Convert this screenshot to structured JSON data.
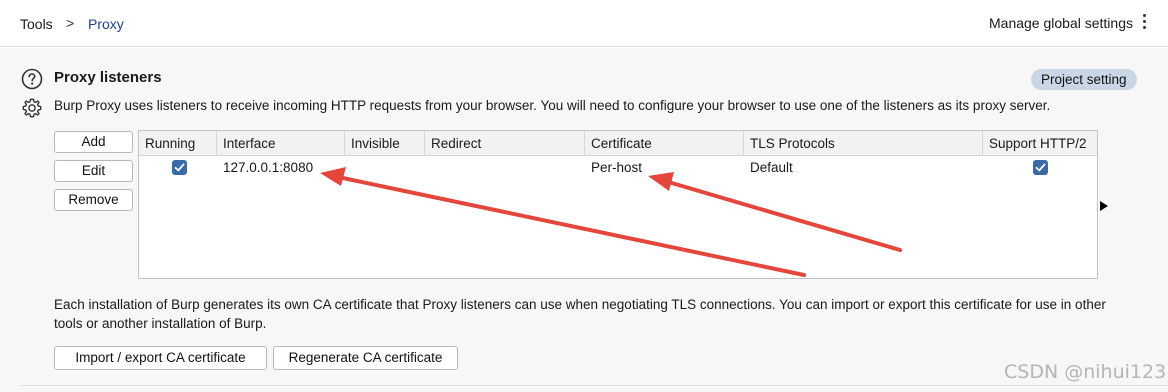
{
  "breadcrumb": {
    "root": "Tools",
    "separator": ">",
    "current": "Proxy"
  },
  "header": {
    "manage_label": "Manage global settings"
  },
  "section": {
    "title": "Proxy listeners",
    "description": "Burp Proxy uses listeners to receive incoming HTTP requests from your browser. You will need to configure your browser to use one of the listeners as its proxy server.",
    "badge": "Project setting"
  },
  "buttons": {
    "add": "Add",
    "edit": "Edit",
    "remove": "Remove"
  },
  "table": {
    "columns": [
      "Running",
      "Interface",
      "Invisible",
      "Redirect",
      "Certificate",
      "TLS Protocols",
      "Support HTTP/2"
    ],
    "rows": [
      {
        "running": true,
        "interface": "127.0.0.1:8080",
        "invisible": "",
        "redirect": "",
        "certificate": "Per-host",
        "tls_protocols": "Default",
        "support_http2": true
      }
    ]
  },
  "ca": {
    "info": "Each installation of Burp generates its own CA certificate that Proxy listeners can use when negotiating TLS connections. You can import or export this certificate for use in other tools or another installation of Burp.",
    "import_label": "Import / export CA certificate",
    "regen_label": "Regenerate CA certificate"
  },
  "watermark": "CSDN @nihui123",
  "colors": {
    "accent": "#3a6aa5",
    "badge_bg": "#c9d6e6",
    "annotation": "#e5463b"
  }
}
